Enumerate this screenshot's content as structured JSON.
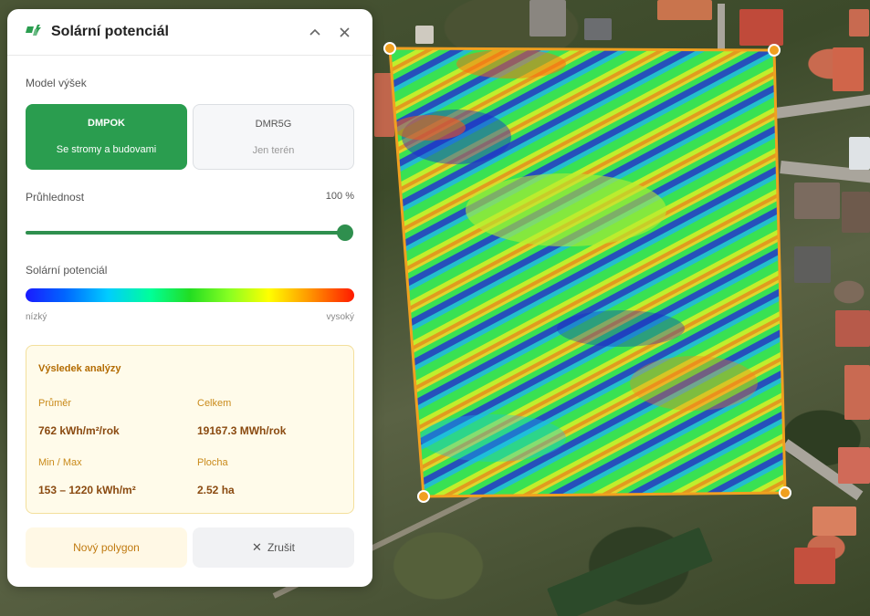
{
  "panel": {
    "title": "Solární potenciál",
    "model_label": "Model výšek",
    "models": [
      {
        "code": "DMPOK",
        "description": "Se stromy a budovami",
        "selected": true
      },
      {
        "code": "DMR5G",
        "description": "Jen terén",
        "selected": false
      }
    ],
    "opacity_label": "Průhlednost",
    "opacity_value": "100 %",
    "opacity_fraction": 1.0,
    "legend_label": "Solární potenciál",
    "legend_low": "nízký",
    "legend_high": "vysoký",
    "result": {
      "title": "Výsledek analýzy",
      "mean_label": "Průměr",
      "mean_value": "762 kWh/m²/rok",
      "total_label": "Celkem",
      "total_value": "19167.3 MWh/rok",
      "minmax_label": "Min / Max",
      "minmax_value": "153 – 1220 kWh/m²",
      "area_label": "Plocha",
      "area_value": "2.52 ha"
    },
    "new_polygon_label": "Nový polygon",
    "cancel_label": "Zrušit"
  },
  "colors": {
    "accent_green": "#2a9d4f",
    "polygon_outline": "#f0a020",
    "result_title": "#b36b00"
  },
  "icons": {
    "logo": "solar-panel-icon",
    "collapse": "chevron-up-icon",
    "close": "close-icon",
    "cancel": "x-icon"
  }
}
